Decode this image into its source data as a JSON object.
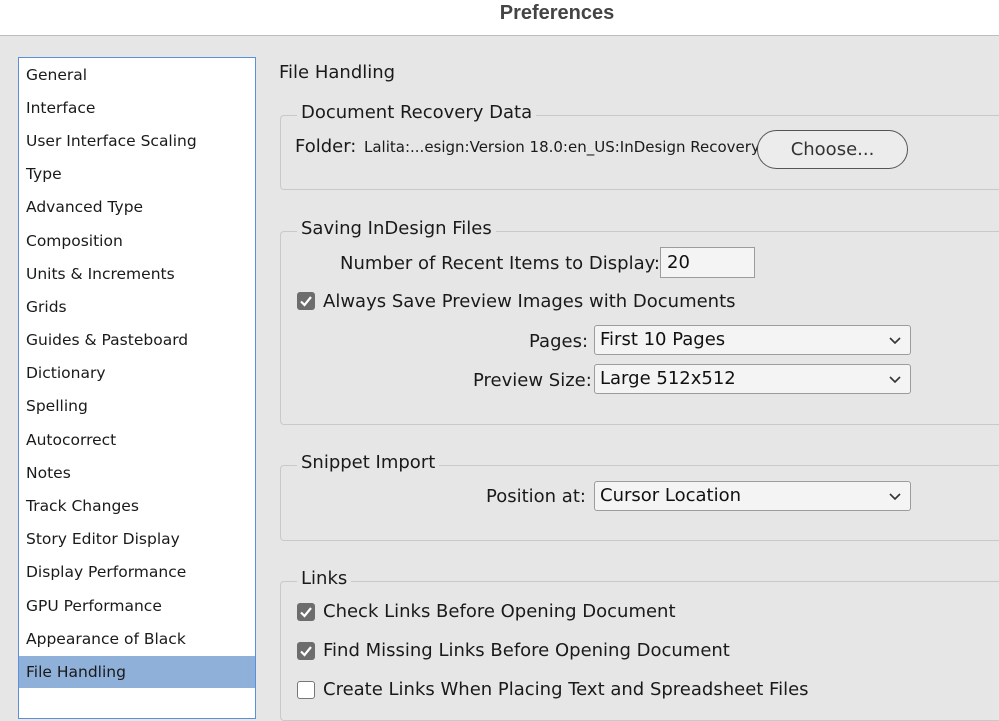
{
  "window": {
    "title": "Preferences"
  },
  "sidebar": {
    "items": [
      {
        "label": "General"
      },
      {
        "label": "Interface"
      },
      {
        "label": "User Interface Scaling"
      },
      {
        "label": "Type"
      },
      {
        "label": "Advanced Type"
      },
      {
        "label": "Composition"
      },
      {
        "label": "Units & Increments"
      },
      {
        "label": "Grids"
      },
      {
        "label": "Guides & Pasteboard"
      },
      {
        "label": "Dictionary"
      },
      {
        "label": "Spelling"
      },
      {
        "label": "Autocorrect"
      },
      {
        "label": "Notes"
      },
      {
        "label": "Track Changes"
      },
      {
        "label": "Story Editor Display"
      },
      {
        "label": "Display Performance"
      },
      {
        "label": "GPU Performance"
      },
      {
        "label": "Appearance of Black"
      },
      {
        "label": "File Handling",
        "selected": true
      }
    ],
    "selected_color": "#8fb0d9"
  },
  "main": {
    "title": "File Handling",
    "recovery": {
      "legend": "Document Recovery Data",
      "folder_label": "Folder:",
      "folder_path": "Lalita:...esign:Version 18.0:en_US:InDesign Recovery",
      "choose_button": "Choose..."
    },
    "saving": {
      "legend": "Saving InDesign Files",
      "recent_label": "Number of Recent Items to Display:",
      "recent_value": "20",
      "always_save_label": "Always Save Preview Images with Documents",
      "always_save_checked": true,
      "pages_label": "Pages:",
      "pages_value": "First 10 Pages",
      "preview_size_label": "Preview Size:",
      "preview_size_value": "Large 512x512"
    },
    "snippet": {
      "legend": "Snippet Import",
      "position_label": "Position at:",
      "position_value": "Cursor Location"
    },
    "links": {
      "legend": "Links",
      "check_links_label": "Check Links Before Opening Document",
      "check_links_checked": true,
      "find_missing_label": "Find Missing Links Before Opening Document",
      "find_missing_checked": true,
      "create_links_label": "Create Links When Placing Text and Spreadsheet Files",
      "create_links_checked": false
    }
  }
}
